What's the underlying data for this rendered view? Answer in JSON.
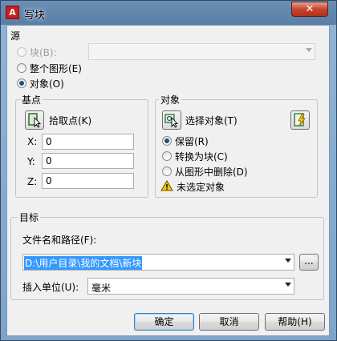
{
  "window": {
    "title": "写块",
    "close_glyph": "✕"
  },
  "source": {
    "heading": "源",
    "options": [
      {
        "label": "块(B):",
        "selected": false,
        "enabled": false
      },
      {
        "label": "整个图形(E)",
        "selected": false,
        "enabled": true
      },
      {
        "label": "对象(O)",
        "selected": true,
        "enabled": true
      }
    ],
    "block_combo_value": ""
  },
  "base_point": {
    "heading": "基点",
    "pick_button_label": "拾取点(K)",
    "x_label": "X:",
    "x_value": "0",
    "y_label": "Y:",
    "y_value": "0",
    "z_label": "Z:",
    "z_value": "0"
  },
  "objects": {
    "heading": "对象",
    "select_button_label": "选择对象(T)",
    "options": [
      {
        "label": "保留(R)",
        "selected": true
      },
      {
        "label": "转换为块(C)",
        "selected": false
      },
      {
        "label": "从图形中删除(D)",
        "selected": false
      }
    ],
    "warning_text": "未选定对象"
  },
  "destination": {
    "heading": "目标",
    "path_label": "文件名和路径(F):",
    "path_value": "D:\\用户目录\\我的文档\\新块",
    "browse_label": "...",
    "units_label": "插入单位(U):",
    "units_value": "毫米"
  },
  "buttons": {
    "ok": "确定",
    "cancel": "取消",
    "help": "帮助(H)"
  },
  "colors": {
    "title_bar": "#5b7ea6",
    "close_button": "#c7442c",
    "selection": "#3399ff",
    "warning": "#f5c400"
  },
  "icons": {
    "app": "autocad-logo-icon",
    "pick_point": "pick-point-icon",
    "select_objects": "select-objects-icon",
    "quick_select": "quick-select-icon",
    "warning": "warning-icon"
  }
}
